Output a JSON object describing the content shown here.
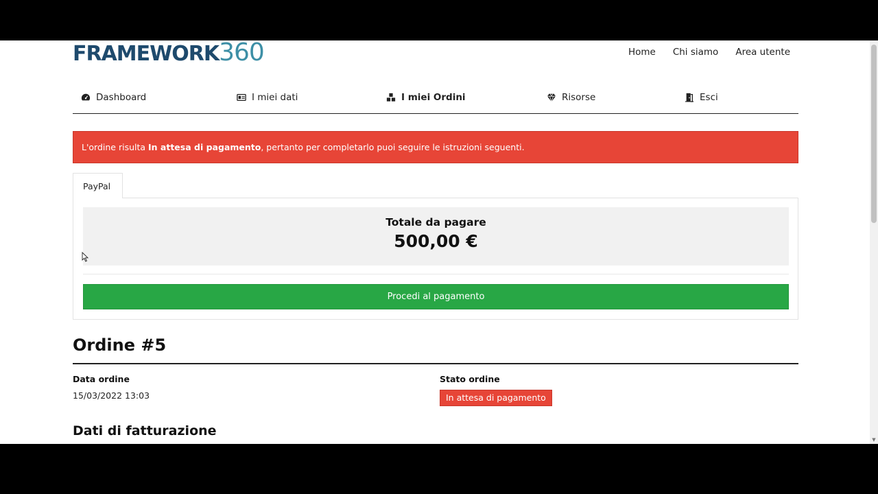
{
  "header": {
    "logo_text": "FRAMEWORK",
    "logo_number": "360",
    "links": [
      "Home",
      "Chi siamo",
      "Area utente"
    ]
  },
  "nav": {
    "items": [
      {
        "label": "Dashboard",
        "icon": "dashboard-icon"
      },
      {
        "label": "I miei dati",
        "icon": "id-card-icon"
      },
      {
        "label": "I miei Ordini",
        "icon": "boxes-icon",
        "active": true
      },
      {
        "label": "Risorse",
        "icon": "gem-icon"
      },
      {
        "label": "Esci",
        "icon": "door-exit-icon"
      }
    ]
  },
  "alert": {
    "text_before": "L'ordine risulta ",
    "text_bold": "In attesa di pagamento",
    "text_after": ", pertanto per completarlo puoi seguire le istruzioni seguenti.",
    "color": "#e74537"
  },
  "payment": {
    "tab_label": "PayPal",
    "total_label": "Totale da pagare",
    "total_value": "500,00 €",
    "button_label": "Procedi al pagamento",
    "button_color": "#28a745"
  },
  "order": {
    "title": "Ordine #5",
    "date_label": "Data ordine",
    "date_value": "15/03/2022 13:03",
    "status_label": "Stato ordine",
    "status_value": "In attesa di pagamento",
    "billing_title": "Dati di fatturazione"
  }
}
